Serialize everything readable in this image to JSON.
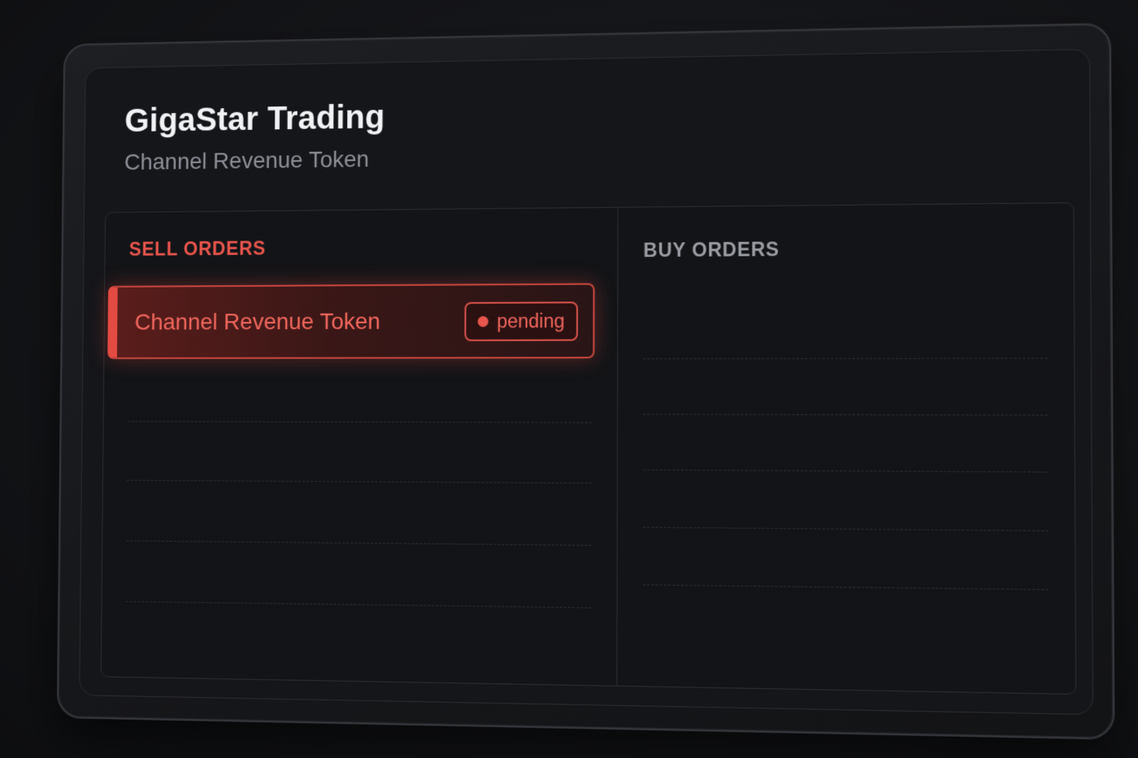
{
  "app": {
    "title": "GigaStar Trading",
    "subtitle": "Channel Revenue Token"
  },
  "sell_panel": {
    "heading": "SELL ORDERS",
    "orders": [
      {
        "name": "Channel Revenue Token",
        "status": "pending"
      }
    ]
  },
  "buy_panel": {
    "heading": "BUY ORDERS",
    "orders": []
  },
  "colors": {
    "sell_accent": "#e8554d",
    "buy_heading": "#9a9da3",
    "background": "#15161a"
  }
}
